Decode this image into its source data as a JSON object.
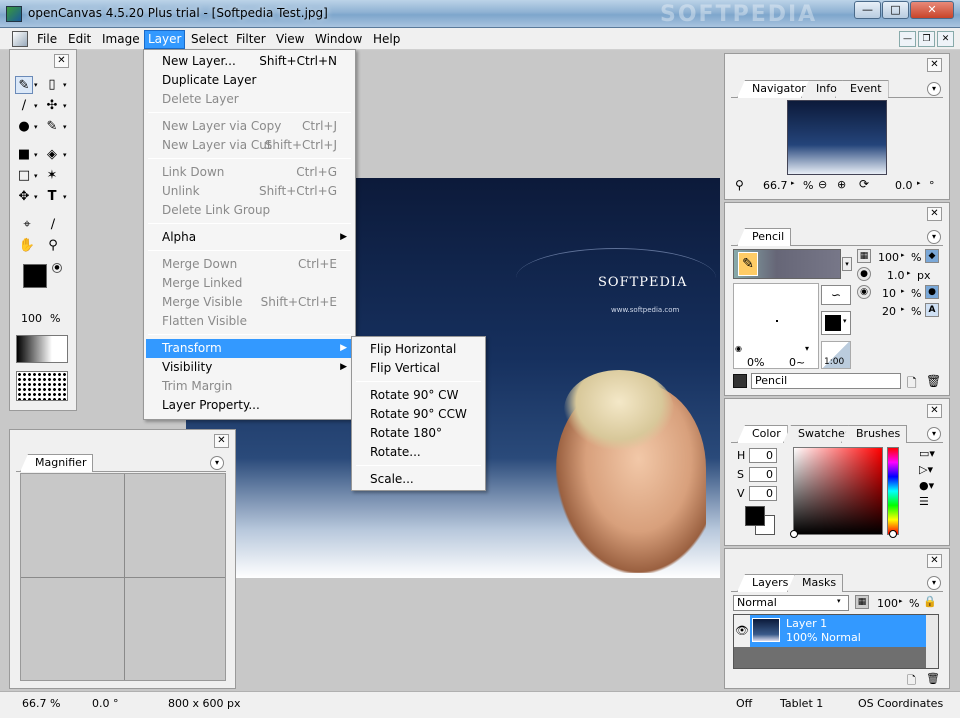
{
  "window": {
    "title": "openCanvas 4.5.20 Plus trial - [Softpedia Test.jpg]",
    "watermark": "SOFTPEDIA"
  },
  "menubar": {
    "items": [
      "File",
      "Edit",
      "Image",
      "Layer",
      "Select",
      "Filter",
      "View",
      "Window",
      "Help"
    ],
    "active": "Layer"
  },
  "layer_menu": {
    "items": [
      {
        "label": "New Layer...",
        "shortcut": "Shift+Ctrl+N"
      },
      {
        "label": "Duplicate Layer",
        "shortcut": ""
      },
      {
        "label": "Delete Layer",
        "shortcut": ""
      },
      {
        "label": "New Layer via Copy",
        "shortcut": "Ctrl+J"
      },
      {
        "label": "New Layer via Cut",
        "shortcut": "Shift+Ctrl+J"
      },
      {
        "label": "Link Down",
        "shortcut": "Ctrl+G"
      },
      {
        "label": "Unlink",
        "shortcut": "Shift+Ctrl+G"
      },
      {
        "label": "Delete Link Group",
        "shortcut": ""
      },
      {
        "label": "Alpha",
        "shortcut": ""
      },
      {
        "label": "Merge Down",
        "shortcut": "Ctrl+E"
      },
      {
        "label": "Merge Linked",
        "shortcut": ""
      },
      {
        "label": "Merge Visible",
        "shortcut": "Shift+Ctrl+E"
      },
      {
        "label": "Flatten Visible",
        "shortcut": ""
      },
      {
        "label": "Transform",
        "shortcut": ""
      },
      {
        "label": "Visibility",
        "shortcut": ""
      },
      {
        "label": "Trim Margin",
        "shortcut": ""
      },
      {
        "label": "Layer Property...",
        "shortcut": ""
      }
    ]
  },
  "transform_menu": {
    "items": [
      "Flip Horizontal",
      "Flip Vertical",
      "Rotate 90° CW",
      "Rotate 90° CCW",
      "Rotate 180°",
      "Rotate...",
      "Scale..."
    ]
  },
  "tools": {
    "opacity_value": "100",
    "opacity_unit": "%"
  },
  "canvas": {
    "brand_text": "SOFTPEDIA",
    "url_text": "www.softpedia.com"
  },
  "magnifier": {
    "tab": "Magnifier"
  },
  "navigator": {
    "tabs": [
      "Navigator",
      "Info",
      "Event"
    ],
    "zoom": "66.7",
    "zoom_unit": "%",
    "angle": "0.0",
    "angle_unit": "°"
  },
  "pencil": {
    "tab": "Pencil",
    "opacity": "100",
    "opacity_unit": "%",
    "size": "1.0",
    "size_unit": "px",
    "density": "10",
    "density_unit": "%",
    "hardness": "20",
    "hardness_unit": "%",
    "preview_left": "0%",
    "preview_right": "0~",
    "preview_scale": "1:00",
    "name": "Pencil"
  },
  "color": {
    "tabs": [
      "Color",
      "Swatches",
      "Brushes"
    ],
    "h_label": "H",
    "s_label": "S",
    "v_label": "V",
    "h": "0",
    "s": "0",
    "v": "0"
  },
  "layers": {
    "tabs": [
      "Layers",
      "Masks"
    ],
    "blend_mode": "Normal",
    "opacity": "100",
    "opacity_unit": "%",
    "layer_name": "Layer 1",
    "layer_desc": "100% Normal"
  },
  "statusbar": {
    "zoom": "66.7 %",
    "angle": "0.0 °",
    "size": "800 x 600 px",
    "pressure": "Off",
    "tablet": "Tablet 1",
    "coords": "OS Coordinates"
  }
}
